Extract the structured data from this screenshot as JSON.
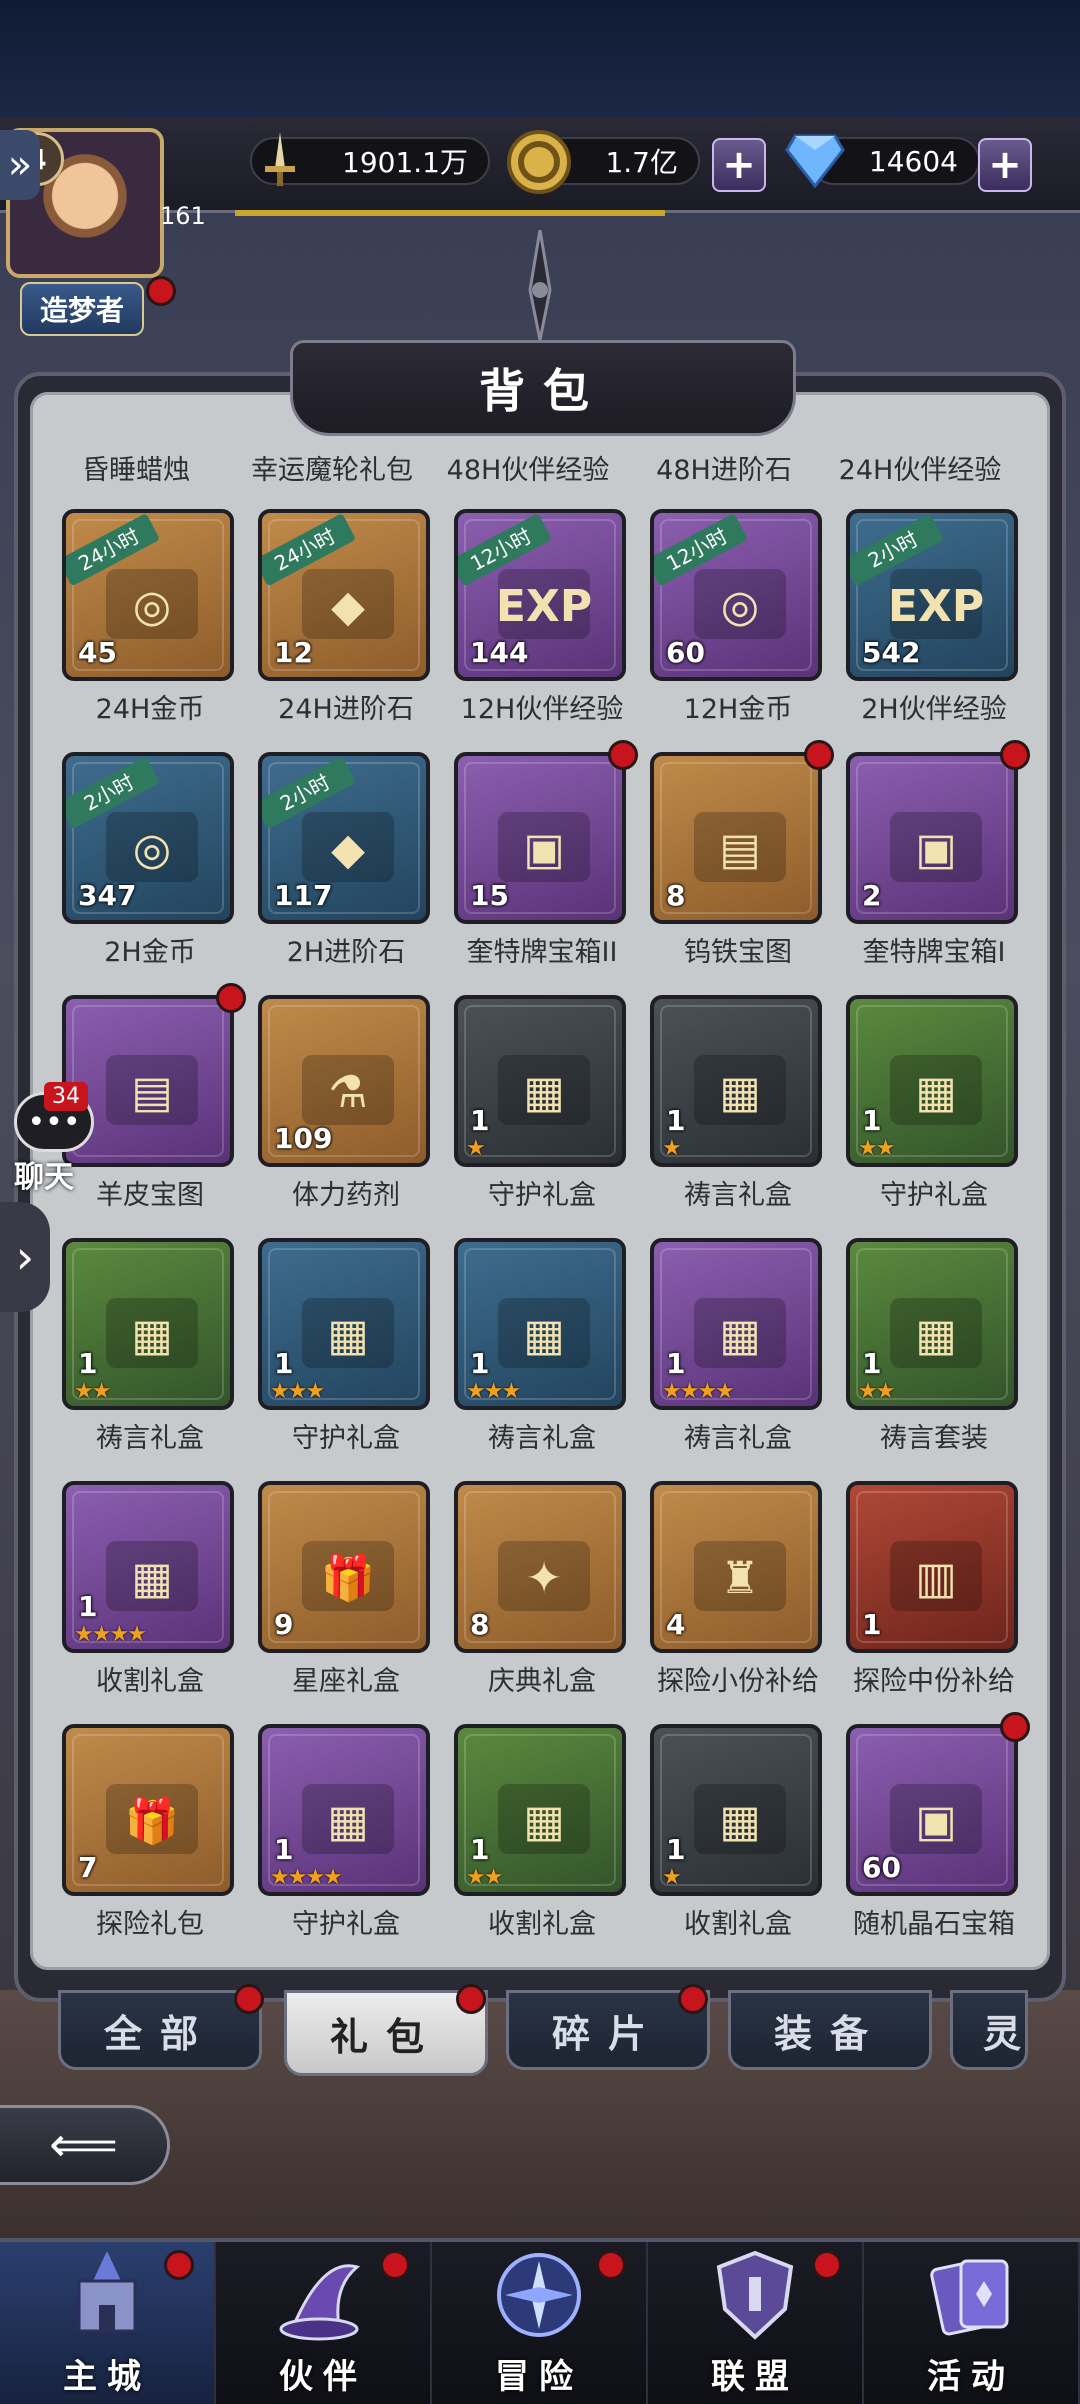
{
  "player": {
    "level": "4",
    "level_value": "161",
    "title": "造梦者"
  },
  "resources": {
    "power": "1901.1万",
    "gold": "1.7亿",
    "diamond": "14604",
    "plus_symbol": "+"
  },
  "panel": {
    "title": "背包"
  },
  "top_labels": [
    "昏睡蜡烛",
    "幸运魔轮礼包",
    "48H伙伴经验",
    "48H进阶石",
    "24H伙伴经验"
  ],
  "items": [
    {
      "name": "24H金币",
      "count": "45",
      "tag": "24小时",
      "color": "gold",
      "icon": "coins-icon",
      "glyph": "◎",
      "stars": 0,
      "dot": false
    },
    {
      "name": "24H进阶石",
      "count": "12",
      "tag": "24小时",
      "color": "gold",
      "icon": "upgrade-stone-icon",
      "glyph": "◆",
      "stars": 0,
      "dot": false
    },
    {
      "name": "12H伙伴经验",
      "count": "144",
      "tag": "12小时",
      "color": "purple",
      "icon": "exp-gift-icon",
      "glyph": "EXP",
      "stars": 0,
      "dot": false
    },
    {
      "name": "12H金币",
      "count": "60",
      "tag": "12小时",
      "color": "purple",
      "icon": "coins-icon",
      "glyph": "◎",
      "stars": 0,
      "dot": false
    },
    {
      "name": "2H伙伴经验",
      "count": "542",
      "tag": "2小时",
      "color": "blue",
      "icon": "exp-gift-icon",
      "glyph": "EXP",
      "stars": 0,
      "dot": false
    },
    {
      "name": "2H金币",
      "count": "347",
      "tag": "2小时",
      "color": "blue",
      "icon": "coins-icon",
      "glyph": "◎",
      "stars": 0,
      "dot": false
    },
    {
      "name": "2H进阶石",
      "count": "117",
      "tag": "2小时",
      "color": "blue",
      "icon": "upgrade-stone-icon",
      "glyph": "◆",
      "stars": 0,
      "dot": false
    },
    {
      "name": "奎特牌宝箱II",
      "count": "15",
      "tag": "",
      "color": "purple",
      "icon": "treasure-chest-icon",
      "glyph": "▣",
      "stars": 0,
      "dot": true
    },
    {
      "name": "钨铁宝图",
      "count": "8",
      "tag": "",
      "color": "gold",
      "icon": "scroll-map-icon",
      "glyph": "▤",
      "stars": 0,
      "dot": true
    },
    {
      "name": "奎特牌宝箱I",
      "count": "2",
      "tag": "",
      "color": "purple",
      "icon": "treasure-chest-icon",
      "glyph": "▣",
      "stars": 0,
      "dot": true
    },
    {
      "name": "羊皮宝图",
      "count": "",
      "tag": "",
      "color": "purple",
      "icon": "parchment-map-icon",
      "glyph": "▤",
      "stars": 0,
      "dot": true
    },
    {
      "name": "体力药剂",
      "count": "109",
      "tag": "",
      "color": "gold",
      "icon": "potion-icon",
      "glyph": "⚗",
      "stars": 0,
      "dot": false
    },
    {
      "name": "守护礼盒",
      "count": "1",
      "tag": "",
      "color": "dark",
      "icon": "guardian-box-icon",
      "glyph": "▦",
      "stars": 1,
      "dot": false
    },
    {
      "name": "祷言礼盒",
      "count": "1",
      "tag": "",
      "color": "dark",
      "icon": "prayer-box-icon",
      "glyph": "▦",
      "stars": 1,
      "dot": false
    },
    {
      "name": "守护礼盒",
      "count": "1",
      "tag": "",
      "color": "green",
      "icon": "guardian-box-icon",
      "glyph": "▦",
      "stars": 2,
      "dot": false
    },
    {
      "name": "祷言礼盒",
      "count": "1",
      "tag": "",
      "color": "green",
      "icon": "prayer-box-icon",
      "glyph": "▦",
      "stars": 2,
      "dot": false
    },
    {
      "name": "守护礼盒",
      "count": "1",
      "tag": "",
      "color": "blue",
      "icon": "guardian-box-icon",
      "glyph": "▦",
      "stars": 3,
      "dot": false
    },
    {
      "name": "祷言礼盒",
      "count": "1",
      "tag": "",
      "color": "blue",
      "icon": "prayer-box-icon",
      "glyph": "▦",
      "stars": 3,
      "dot": false
    },
    {
      "name": "祷言礼盒",
      "count": "1",
      "tag": "",
      "color": "purple",
      "icon": "prayer-box-icon",
      "glyph": "▦",
      "stars": 4,
      "dot": false
    },
    {
      "name": "祷言套装",
      "count": "1",
      "tag": "",
      "color": "green",
      "icon": "prayer-set-icon",
      "glyph": "▦",
      "stars": 2,
      "dot": false
    },
    {
      "name": "收割礼盒",
      "count": "1",
      "tag": "",
      "color": "purple",
      "icon": "harvest-box-icon",
      "glyph": "▦",
      "stars": 4,
      "dot": false
    },
    {
      "name": "星座礼盒",
      "count": "9",
      "tag": "",
      "color": "gold",
      "icon": "gift-box-icon",
      "glyph": "🎁",
      "stars": 0,
      "dot": false
    },
    {
      "name": "庆典礼盒",
      "count": "8",
      "tag": "",
      "color": "gold",
      "icon": "celebration-box-icon",
      "glyph": "✦",
      "stars": 0,
      "dot": false
    },
    {
      "name": "探险小份补给",
      "count": "4",
      "tag": "",
      "color": "gold",
      "icon": "supply-bag-icon",
      "glyph": "♜",
      "stars": 0,
      "dot": false
    },
    {
      "name": "探险中份补给",
      "count": "1",
      "tag": "",
      "color": "red",
      "icon": "backpack-icon",
      "glyph": "▥",
      "stars": 0,
      "dot": false
    },
    {
      "name": "探险礼包",
      "count": "7",
      "tag": "",
      "color": "gold",
      "icon": "gift-box-icon",
      "glyph": "🎁",
      "stars": 0,
      "dot": false
    },
    {
      "name": "守护礼盒",
      "count": "1",
      "tag": "",
      "color": "purple",
      "icon": "guardian-box-icon",
      "glyph": "▦",
      "stars": 4,
      "dot": false
    },
    {
      "name": "收割礼盒",
      "count": "1",
      "tag": "",
      "color": "green",
      "icon": "harvest-box-icon",
      "glyph": "▦",
      "stars": 2,
      "dot": false
    },
    {
      "name": "收割礼盒",
      "count": "1",
      "tag": "",
      "color": "dark",
      "icon": "harvest-box-icon",
      "glyph": "▦",
      "stars": 1,
      "dot": false
    },
    {
      "name": "随机晶石宝箱",
      "count": "60",
      "tag": "",
      "color": "purple",
      "icon": "crystal-chest-icon",
      "glyph": "▣",
      "stars": 0,
      "dot": true
    }
  ],
  "tabs": [
    "全部",
    "礼包",
    "碎片",
    "装备",
    "灵"
  ],
  "chat": {
    "count": "34",
    "label": "聊天"
  },
  "nav": [
    "主城",
    "伙伴",
    "冒险",
    "联盟",
    "活动"
  ],
  "colors": {
    "star": "#f0a020",
    "red_dot": "#c8141c",
    "panel_bg": "#c6cacd"
  }
}
